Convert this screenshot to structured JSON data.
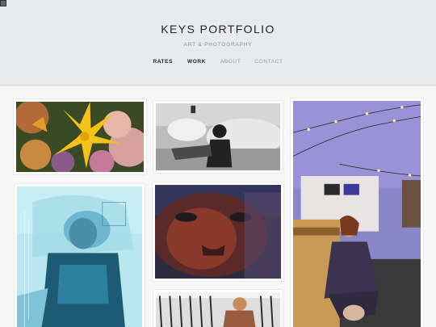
{
  "site": {
    "title": "KEYS PORTFOLIO",
    "subtitle": "ART & PHOTOGRAPHY"
  },
  "nav": {
    "items": [
      {
        "label": "RATES",
        "active": true
      },
      {
        "label": "WORK",
        "active": true
      },
      {
        "label": "ABOUT",
        "active": false
      },
      {
        "label": "CONTACT",
        "active": false
      }
    ]
  },
  "colors": {
    "header_bg": "#e8eaee",
    "page_bg": "#f7f7f7",
    "nav_active": "#222222",
    "nav_inactive": "#9aa0a6"
  }
}
